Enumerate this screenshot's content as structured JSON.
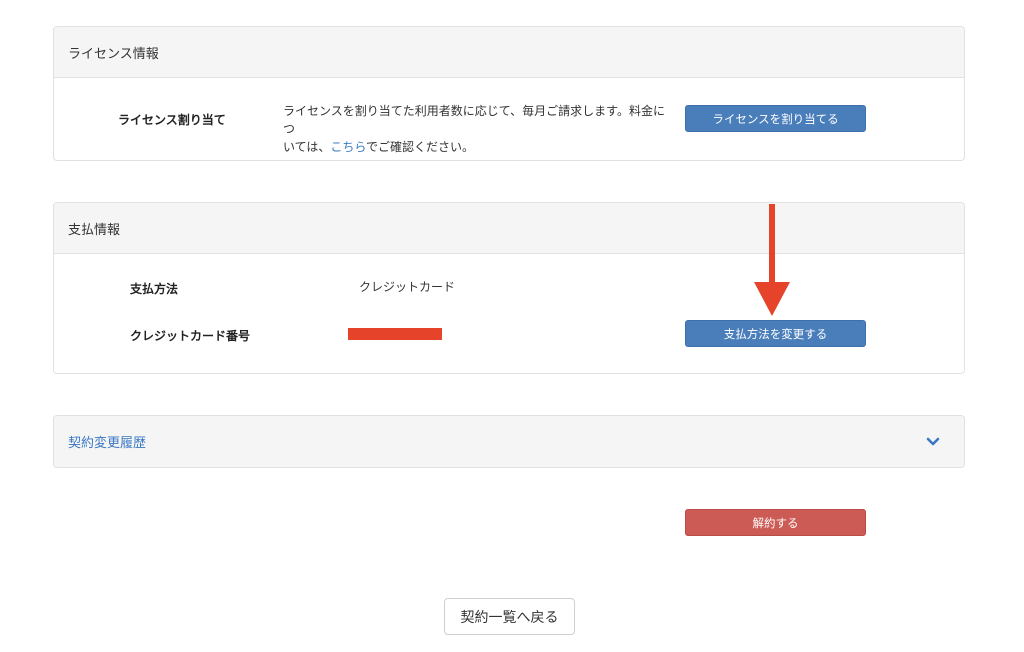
{
  "license": {
    "title": "ライセンス情報",
    "label": "ライセンス割り当て",
    "desc_line1": "ライセンスを割り当てた利用者数に応じて、毎月ご請求します。料金につ",
    "desc_line2_pre": "いては、",
    "desc_link": "こちら",
    "desc_line2_post": "でご確認ください。",
    "button": "ライセンスを割り当てる"
  },
  "payment": {
    "title": "支払情報",
    "method_label": "支払方法",
    "method_value": "クレジットカード",
    "card_label": "クレジットカード番号",
    "button": "支払方法を変更する"
  },
  "history": {
    "title": "契約変更履歴"
  },
  "cancel_button": "解約する",
  "back_button": "契約一覧へ戻る",
  "colors": {
    "primary": "#4a7ebb",
    "danger": "#cc5a55",
    "annotation": "#e5432a",
    "link": "#3a78c3"
  },
  "icons": {
    "history_toggle": "chevron-down-icon",
    "annotation": "arrow-down-icon"
  }
}
